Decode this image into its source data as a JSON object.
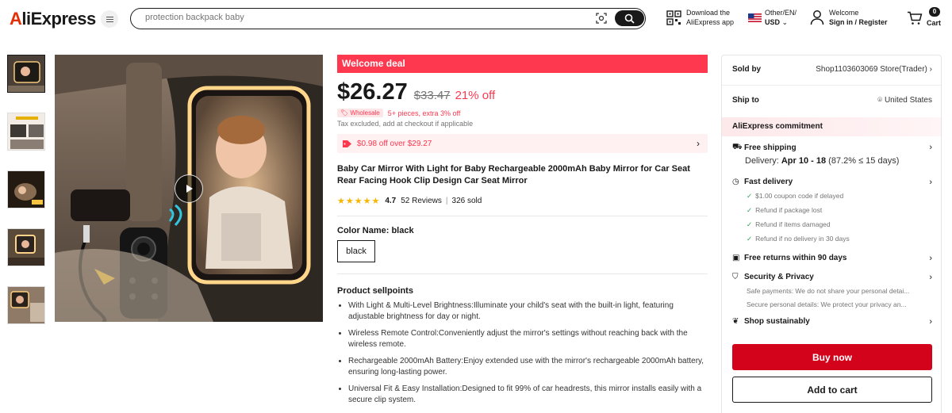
{
  "header": {
    "logo": "AliExpress",
    "search_placeholder": "protection backpack baby",
    "app_line1": "Download the",
    "app_line2": "AliExpress app",
    "locale_line1": "Other/EN/",
    "locale_line2": "USD",
    "account_line1": "Welcome",
    "account_line2": "Sign in / Register",
    "cart_count": "0",
    "cart_label": "Cart"
  },
  "product": {
    "deal_label": "Welcome deal",
    "price": "$26.27",
    "old_price": "$33.47",
    "discount": "21% off",
    "wholesale_badge": "Wholesale",
    "wholesale_text": "5+ pieces, extra 3% off",
    "tax_note": "Tax excluded, add at checkout if applicable",
    "coupon": "$0.98 off over $29.27",
    "title": "Baby Car Mirror With Light for Baby Rechargeable 2000mAh Baby Mirror for Car Seat Rear Facing Hook Clip Design Car Seat Mirror",
    "stars": "★★★★★",
    "rating": "4.7",
    "reviews": "52 Reviews",
    "sold": "326 sold",
    "color_label": "Color Name: black",
    "color_option": "black",
    "sellpoints_title": "Product sellpoints",
    "sellpoints": [
      "With Light & Multi-Level Brightness:Illuminate your child's seat with the built-in light, featuring adjustable brightness for day or night.",
      "Wireless Remote Control:Conveniently adjust the mirror's settings without reaching back with the wireless remote.",
      "Rechargeable 2000mAh Battery:Enjoy extended use with the mirror's rechargeable 2000mAh battery, ensuring long-lasting power.",
      "Universal Fit & Easy Installation:Designed to fit 99% of car headrests, this mirror installs easily with a secure clip system."
    ]
  },
  "sidebar": {
    "sold_by_label": "Sold by",
    "store_name": "Shop1103603069 Store(Trader)",
    "ship_to_label": "Ship to",
    "ship_to_value": "United States",
    "commitment_title": "AliExpress commitment",
    "free_shipping": "Free shipping",
    "delivery_prefix": "Delivery:",
    "delivery_dates": "Apr 10 - 18",
    "delivery_suffix": "(87.2% ≤ 15 days)",
    "fast_delivery": "Fast delivery",
    "fast_items": [
      "$1.00 coupon code if delayed",
      "Refund if package lost",
      "Refund if items damaged",
      "Refund if no delivery in 30 days"
    ],
    "free_returns": "Free returns within 90 days",
    "security": "Security & Privacy",
    "security_items": [
      "Safe payments: We do not share your personal detai...",
      "Secure personal details: We protect your privacy an..."
    ],
    "sustainable": "Shop sustainably",
    "buy_now": "Buy now",
    "add_to_cart": "Add to cart"
  }
}
